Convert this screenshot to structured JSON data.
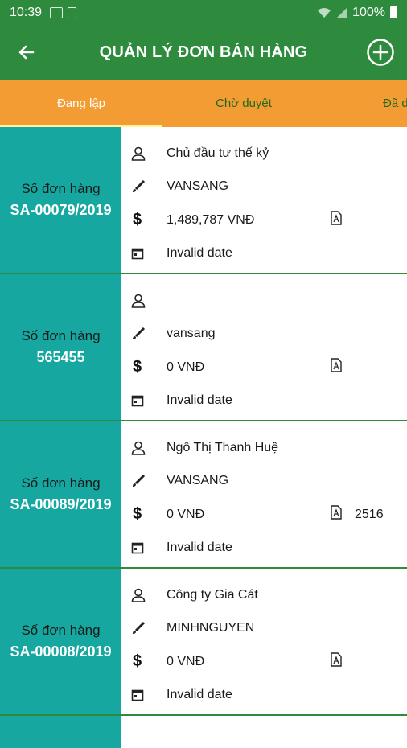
{
  "status_bar": {
    "time": "10:39",
    "battery": "100%"
  },
  "header": {
    "title": "QUẢN LÝ ĐƠN BÁN HÀNG"
  },
  "tabs": [
    {
      "label": "Đang lập"
    },
    {
      "label": "Chờ duyệt"
    },
    {
      "label": "Đã d"
    }
  ],
  "orders": [
    {
      "label": "Số đơn hàng",
      "number": "SA-00079/2019",
      "customer": "Chủ đầu tư thế kỷ",
      "creator": "VANSANG",
      "amount": "1,489,787 VNĐ",
      "pdf_code": "",
      "date": "Invalid date"
    },
    {
      "label": "Số đơn hàng",
      "number": "565455",
      "customer": "",
      "creator": "vansang",
      "amount": "0 VNĐ",
      "pdf_code": "",
      "date": "Invalid date"
    },
    {
      "label": "Số đơn hàng",
      "number": "SA-00089/2019",
      "customer": "Ngô Thị Thanh Huệ",
      "creator": "VANSANG",
      "amount": "0 VNĐ",
      "pdf_code": "2516",
      "date": "Invalid date"
    },
    {
      "label": "Số đơn hàng",
      "number": "SA-00008/2019",
      "customer": "Công ty Gia Cát",
      "creator": "MINHNGUYEN",
      "amount": "0 VNĐ",
      "pdf_code": "",
      "date": "Invalid date"
    }
  ],
  "icons": {
    "back": "arrow-left-icon",
    "add": "plus-circle-icon",
    "customer": "person-icon",
    "creator": "pen-icon",
    "amount": "dollar-icon",
    "pdf": "pdf-file-icon",
    "date": "calendar-icon"
  },
  "colors": {
    "header": "#2e8b3e",
    "tabs": "#f39c33",
    "order_panel": "#16a7a0"
  }
}
